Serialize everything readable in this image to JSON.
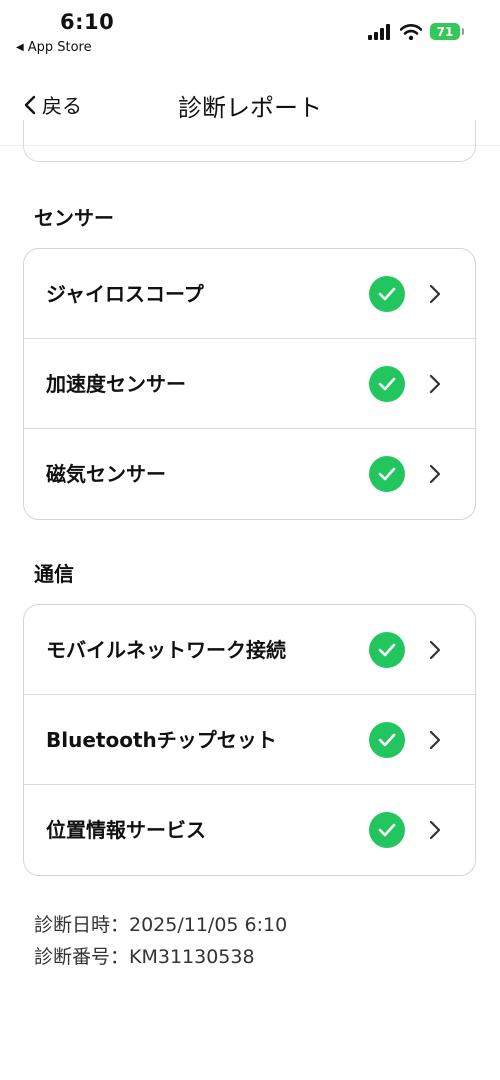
{
  "status_bar": {
    "time": "6:10",
    "back_app": "App Store",
    "battery": "71",
    "icons": [
      "signal-icon",
      "wifi-icon",
      "battery-icon"
    ]
  },
  "nav": {
    "back_label": "戻る",
    "title": "診断レポート"
  },
  "sections": [
    {
      "title": "センサー",
      "items": [
        {
          "label": "ジャイロスコープ",
          "status": "ok"
        },
        {
          "label": "加速度センサー",
          "status": "ok"
        },
        {
          "label": "磁気センサー",
          "status": "ok"
        }
      ]
    },
    {
      "title": "通信",
      "items": [
        {
          "label": "モバイルネットワーク接続",
          "status": "ok"
        },
        {
          "label": "Bluetoothチップセット",
          "status": "ok"
        },
        {
          "label": "位置情報サービス",
          "status": "ok"
        }
      ]
    }
  ],
  "footer": {
    "date_line": "診断日時：2025/11/05 6:10",
    "number_line": "診断番号：KM31130538"
  },
  "colors": {
    "check": "#22c55e",
    "battery": "#34c759"
  }
}
